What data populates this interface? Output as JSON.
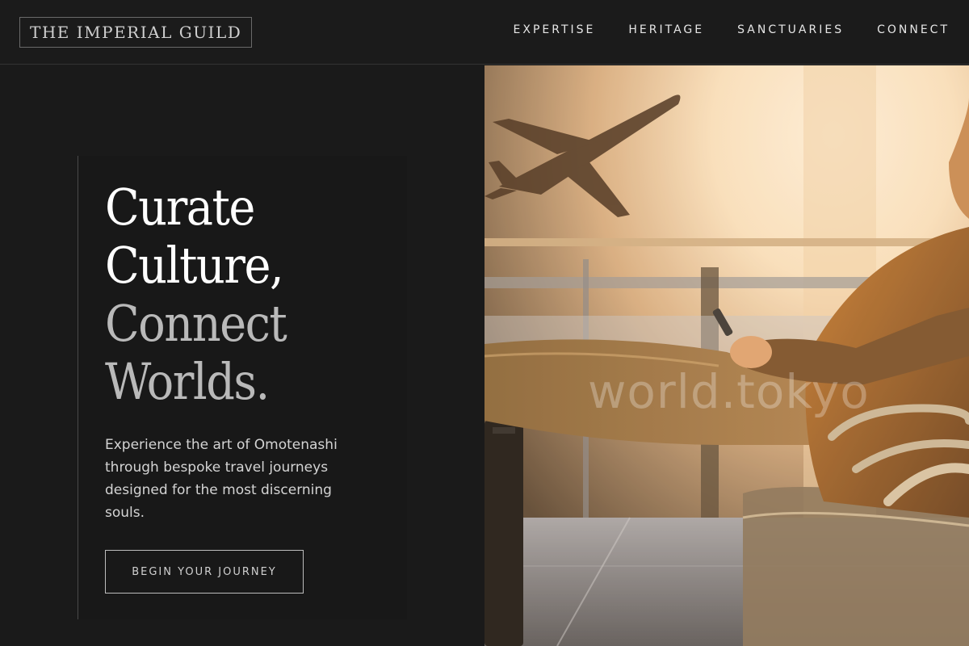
{
  "header": {
    "logo_text": "THE IMPERIAL GUILD",
    "nav": [
      {
        "label": "EXPERTISE"
      },
      {
        "label": "HERITAGE"
      },
      {
        "label": "SANCTUARIES"
      },
      {
        "label": "CONNECT"
      }
    ]
  },
  "hero": {
    "headline": {
      "line1": "Curate",
      "line2": "Culture,",
      "line3": "Connect",
      "line4": "Worlds."
    },
    "subtext": "Experience the art of Omotenashi through bespoke travel journeys designed for the most discerning souls.",
    "cta_label": "BEGIN YOUR JOURNEY",
    "image": {
      "watermark": "world.tokyo",
      "icon": "airport-traveler-photo"
    }
  },
  "colors": {
    "background": "#1a1a1a",
    "text_primary": "#ffffff",
    "text_muted": "#b9b9b9",
    "accent_warm": "#e8a04a"
  }
}
